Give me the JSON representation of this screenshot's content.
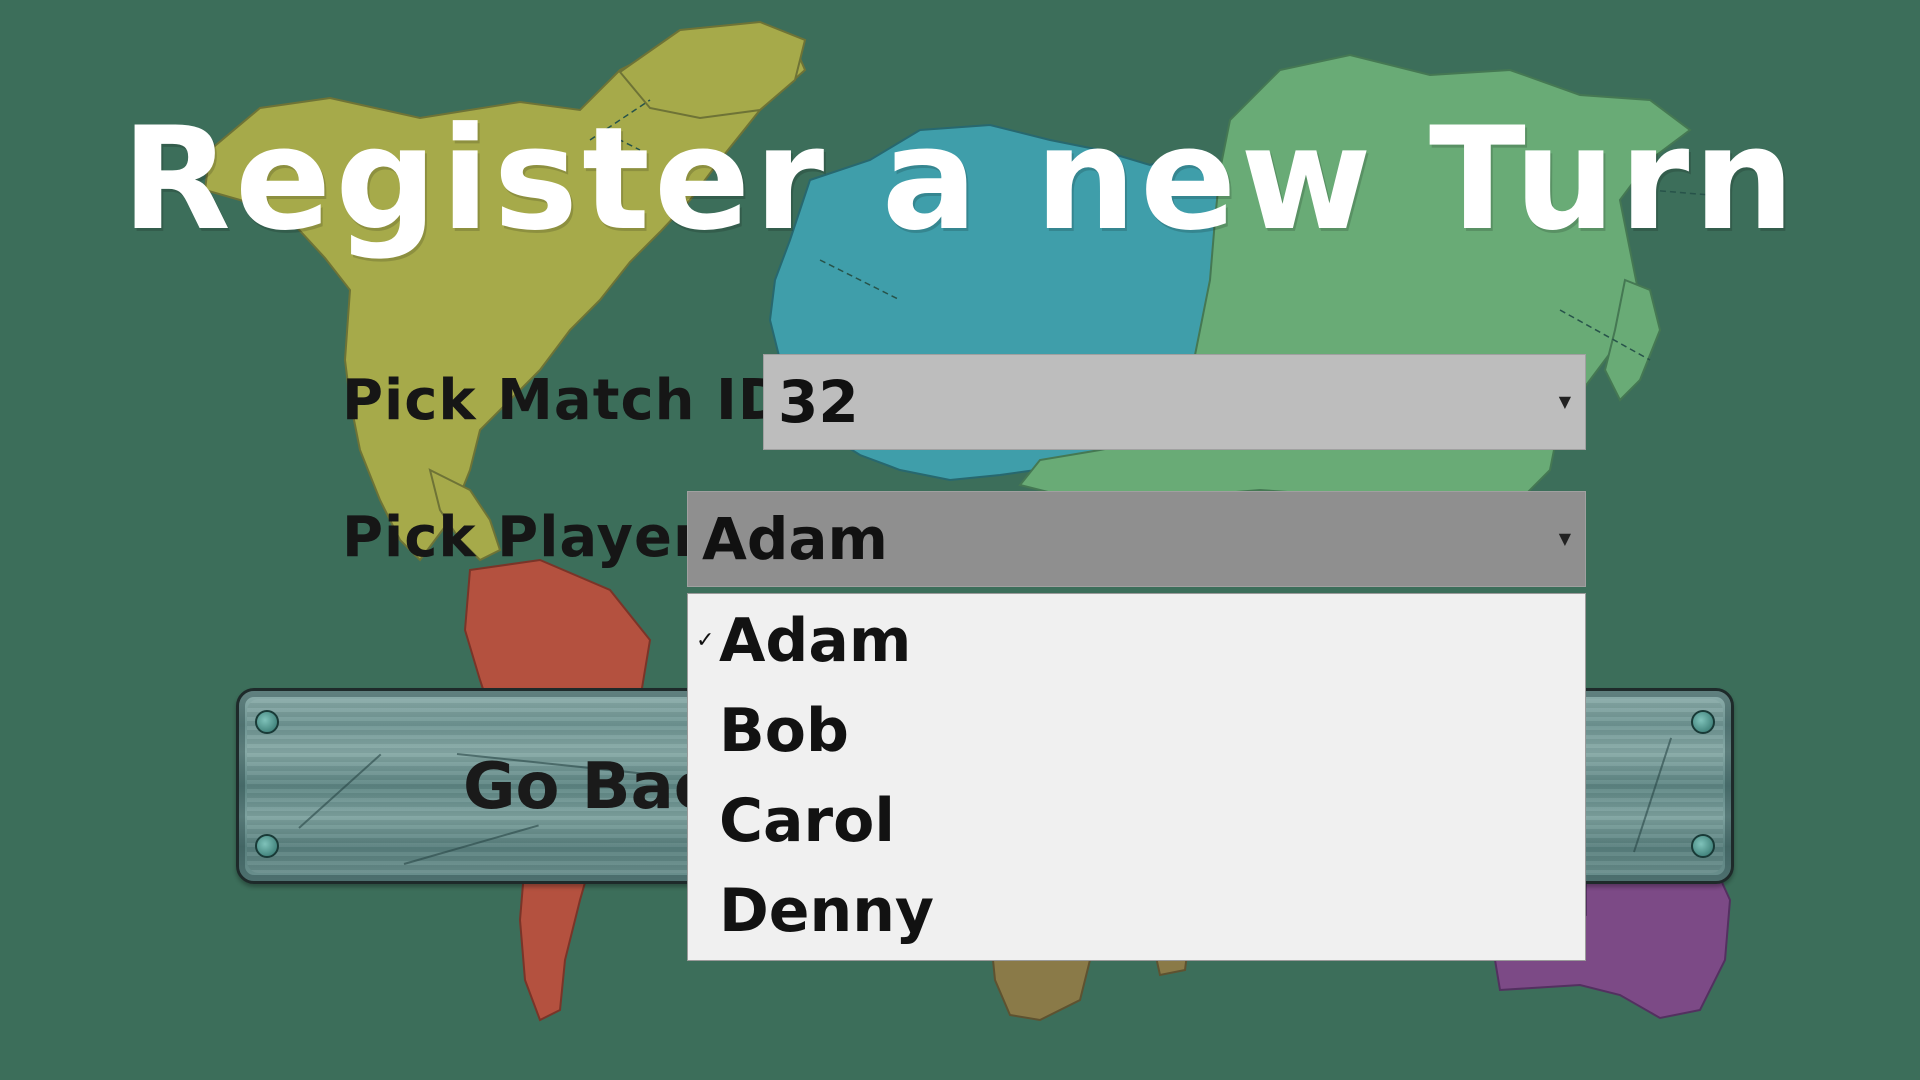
{
  "title": "Register a new Turn",
  "form": {
    "match_label": "Pick Match ID",
    "match_value": "32",
    "player_label": "Pick Player",
    "player_value": "Adam",
    "player_options": [
      "Adam",
      "Bob",
      "Carol",
      "Denny"
    ],
    "selected_option": "Adam"
  },
  "buttons": {
    "go_back_label": "Go Back"
  },
  "icons": {
    "select_arrow": "triangle-down-icon",
    "selected_check": "checkmark-icon"
  },
  "colors": {
    "background": "#3c6e5a",
    "north_america": "#a6aa4a",
    "europe": "#3f9eaa",
    "asia": "#69ab76",
    "south_america": "#b4513f",
    "africa": "#8a7a48",
    "australia": "#7c4a86",
    "match_select_bg": "#bdbdbd",
    "player_select_bg": "#8f8f8f",
    "dropdown_bg": "#f0f0f0"
  }
}
